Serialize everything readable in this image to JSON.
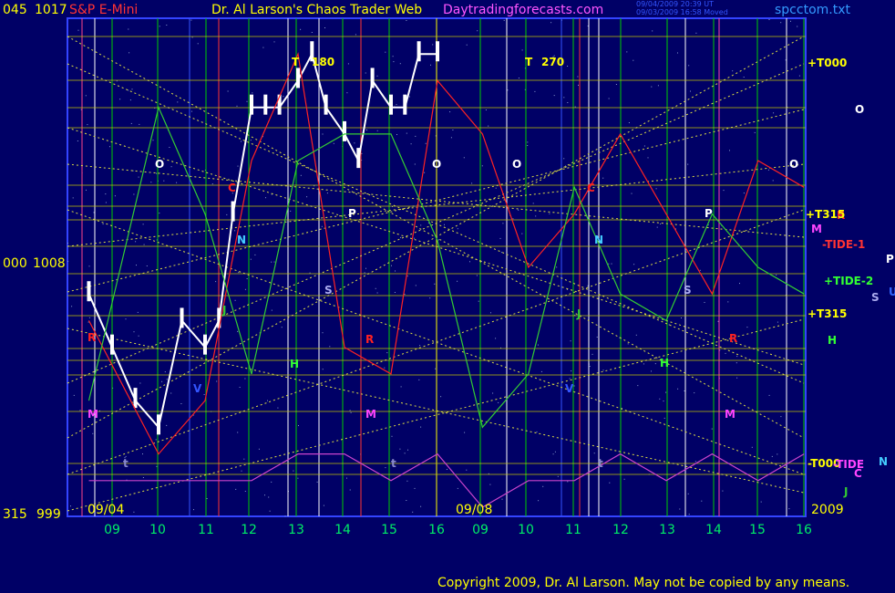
{
  "header": {
    "price_left": "045",
    "price_val": "1017",
    "symbol": "S&P E-Mini",
    "title": "Dr. Al Larson's Chaos Trader Web",
    "site": "Daytradingforecasts.com",
    "stamp1": "09/04/2009 20:39 UT",
    "stamp2": "09/03/2009 16:58 Moved",
    "file": "spcctom.txt"
  },
  "yaxis": {
    "mid_left": "000",
    "mid_val": "1008",
    "bot_left": "315",
    "bot_val": "999"
  },
  "dates": {
    "d1": "09/04",
    "d2": "09/08",
    "year": "2009"
  },
  "hours": [
    "09",
    "10",
    "11",
    "12",
    "13",
    "14",
    "15",
    "16",
    "09",
    "10",
    "11",
    "12",
    "13",
    "14",
    "15",
    "16"
  ],
  "right_labels": {
    "t000_top": "+T000",
    "t315_a": "+T315",
    "tide1": "-TIDE-1",
    "tide2": "+TIDE-2",
    "t315_b": "+T315",
    "t000_bot": "-T000",
    "tide": "-TIDE"
  },
  "planet_labels": {
    "O": "O",
    "P": "P",
    "S": "S",
    "N": "N",
    "R": "R",
    "M": "M",
    "H": "H",
    "J": "J",
    "V": "V",
    "C": "C",
    "U": "U",
    "T": "T",
    "t": "t"
  },
  "angles": {
    "a180": "180",
    "a270": "270"
  },
  "copyright": "Copyright 2009, Dr. Al Larson. May not be copied by any means.",
  "colors": {
    "background": "#000066",
    "grid": "#cccc00",
    "hour_line": "#00cc00",
    "price_bars": "#ffffff",
    "tide_red": "#ff2222",
    "tide_green": "#33cc33",
    "tide_magenta": "#cc44cc",
    "label_yellow": "#ffff00"
  },
  "chart_data": {
    "type": "line",
    "title": "S&P E-Mini",
    "ylim": [
      999,
      1017
    ],
    "y_ticks": [
      999,
      1008,
      1017
    ],
    "x_ticks": [
      "09",
      "10",
      "11",
      "12",
      "13",
      "14",
      "15",
      "16",
      "09",
      "10",
      "11",
      "12",
      "13",
      "14",
      "15",
      "16"
    ],
    "dates": [
      "09/04",
      "09/08"
    ],
    "series": [
      {
        "name": "S&P E-Mini",
        "x": [
          8.5,
          9,
          9.5,
          10,
          10.5,
          11,
          11.3,
          11.6,
          12,
          12.3,
          12.6,
          13,
          13.3,
          13.6,
          14,
          14.3,
          14.6,
          15,
          15.3,
          15.6,
          16
        ],
        "values": [
          1007,
          1005,
          1003,
          1002,
          1006,
          1005,
          1006,
          1010,
          1014,
          1014,
          1014,
          1015,
          1016,
          1014,
          1013,
          1012,
          1015,
          1014,
          1014,
          1016,
          1016
        ]
      },
      {
        "name": "TIDE-1",
        "x": [
          8.5,
          10,
          11,
          12,
          13,
          14,
          15,
          16,
          17,
          18,
          19,
          20,
          21,
          22,
          23,
          24
        ],
        "values": [
          1006,
          1001,
          1003,
          1012,
          1016,
          1005,
          1004,
          1015,
          1013,
          1008,
          1010,
          1013,
          1010,
          1007,
          1012,
          1011
        ]
      },
      {
        "name": "TIDE-2",
        "x": [
          8.5,
          10,
          11,
          12,
          13,
          14,
          15,
          16,
          17,
          18,
          19,
          20,
          21,
          22,
          23,
          24
        ],
        "values": [
          1003,
          1014,
          1010,
          1004,
          1012,
          1013,
          1013,
          1009,
          1002,
          1004,
          1011,
          1007,
          1006,
          1010,
          1008,
          1007
        ]
      },
      {
        "name": "TIDE",
        "x": [
          8.5,
          10,
          11,
          12,
          13,
          14,
          15,
          16,
          17,
          18,
          19,
          20,
          21,
          22,
          23,
          24
        ],
        "values": [
          1000,
          1000,
          1000,
          1000,
          1001,
          1001,
          1000,
          1001,
          999,
          1000,
          1000,
          1001,
          1000,
          1001,
          1000,
          1001
        ]
      }
    ]
  }
}
